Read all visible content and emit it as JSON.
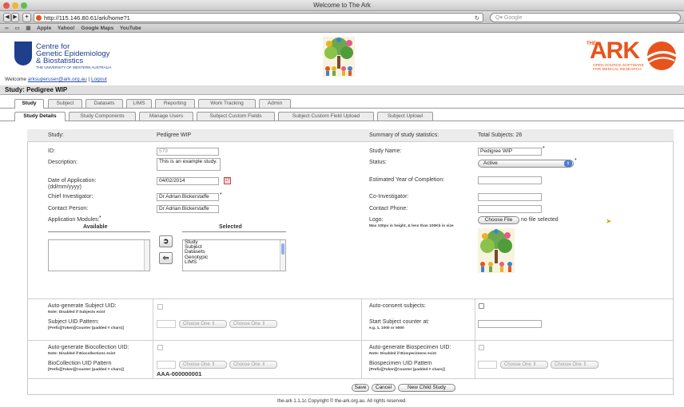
{
  "window": {
    "title": "Welcome to The Ark"
  },
  "browser": {
    "url": "http://115.146.80.61/ark/home?1",
    "search_placeholder": "Q▾ Google",
    "bookmarks": [
      "Apple",
      "Yahoo!",
      "Google Maps",
      "YouTube"
    ]
  },
  "header": {
    "org_line1": "Centre for",
    "org_line2": "Genetic Epidemiology",
    "org_line3": "& Biostatistics",
    "org_sub": "THE UNIVERSITY OF WESTERN AUSTRALIA",
    "ark_logo": "ARK",
    "ark_logo_prefix": "THE",
    "ark_tagline1": "OPEN SOURCE SOFTWARE",
    "ark_tagline2": "FOR MEDICAL RESEARCH",
    "welcome": "Welcome",
    "user": "arksuperuser@ark.org.au",
    "separator": "|",
    "logout": "Logout",
    "study_title": "Study: Pedigree WIP"
  },
  "main_tabs": [
    "Study",
    "Subject",
    "Datasets",
    "LIMS",
    "Reporting",
    "Work Tracking",
    "Admin"
  ],
  "sub_tabs": [
    "Study Details",
    "Study Components",
    "Manage Users",
    "Subject Custom Fields",
    "Subject Custom Field Upload",
    "Subject Upload"
  ],
  "form": {
    "header_study_label": "Study:",
    "header_study_value": "Pedigree WIP",
    "header_summary": "Summary of study statistics:",
    "header_total": "Total Subjects: 26",
    "id_label": "ID:",
    "id_value": "579",
    "description_label": "Description:",
    "description_value": "This is an example study.",
    "date_label": "Date of Application:",
    "date_format": "(dd/mm/yyyy)",
    "date_value": "04/02/2014",
    "chief_label": "Chief Investigator:",
    "chief_value": "Dr Adrian Bickerstaffe",
    "contact_label": "Contact Person:",
    "contact_value": "Dr Adrian Bickerstaffe",
    "modules_label": "Application Modules:",
    "available_label": "Available",
    "selected_label": "Selected",
    "selected_modules": [
      "Study",
      "Subject",
      "Datasets",
      "Genotypic",
      "LIMS"
    ],
    "study_name_label": "Study Name:",
    "study_name_value": "Pedigree WIP",
    "status_label": "Status:",
    "status_value": "Active",
    "est_year_label": "Estimated Year of Completion:",
    "coinv_label": "Co-Investigator:",
    "contact_phone_label": "Contact Phone:",
    "logo_label": "Logo:",
    "logo_note": "Max 100px in height, & less than 100Kb in size",
    "choose_file": "Choose File",
    "no_file": "no file selected",
    "auto_subject_label": "Auto-generate Subject UID:",
    "auto_subject_note": "Note: Disabled if Subjects exist",
    "subject_pattern_label": "Subject UID Pattern:",
    "pattern_note": "[Prefix][Token][Counter (padded # chars)]",
    "choose_one": "Choose One",
    "auto_consent_label": "Auto-consent subjects:",
    "start_counter_label": "Start Subject counter at:",
    "start_counter_note": "e.g. 1, 1000 or 5000",
    "auto_bio_label": "Auto-generate Biocollection UID:",
    "auto_bio_note": "Note: Disabled if Biocollections exist",
    "bio_pattern_label": "BioCollection UID Pattern",
    "bio_example": "AAA-000000001",
    "auto_biospec_label": "Auto-generate Biospecimen UID:",
    "auto_biospec_note": "Note: Disabled if Biospecimens exist",
    "biospec_pattern_label": "Biospecimen UID Pattern",
    "save": "Save",
    "cancel": "Cancel",
    "new_child": "New Child Study",
    "req_mark": "*"
  },
  "footer": "the-ark 1.1.1c Copyright © the-ark.org.au. All rights reserved.",
  "colors": {
    "ark_orange": "#e8531c",
    "uwa_blue": "#1d3f8c",
    "link_blue": "#2a52a8"
  }
}
